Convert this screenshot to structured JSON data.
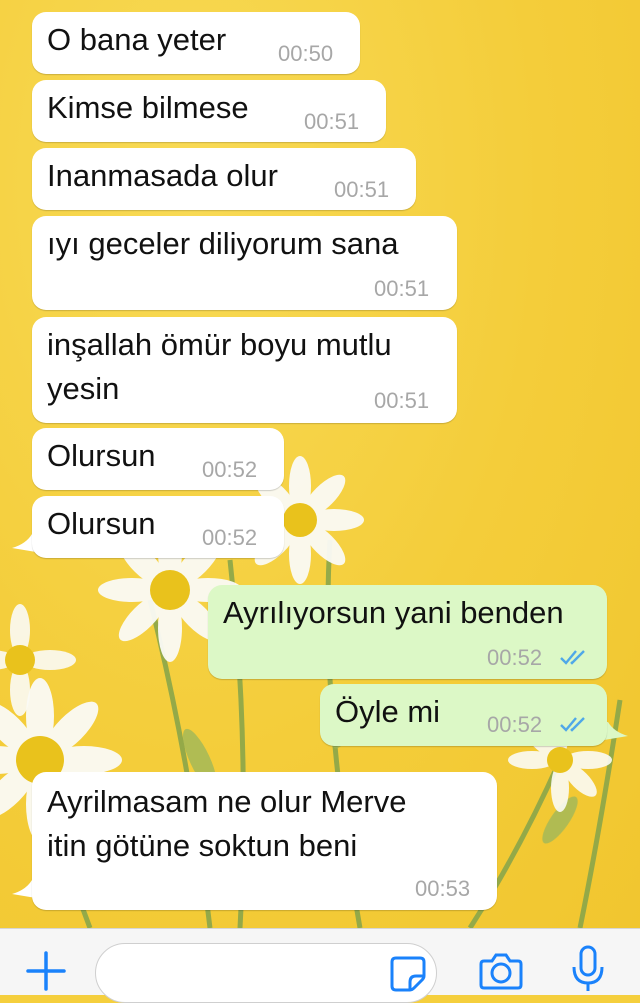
{
  "messages": [
    {
      "direction": "incoming",
      "text": "O bana yeter",
      "time": "00:50"
    },
    {
      "direction": "incoming",
      "text": "Kimse bilmese",
      "time": "00:51"
    },
    {
      "direction": "incoming",
      "text": "Inanmasada olur",
      "time": "00:51"
    },
    {
      "direction": "incoming",
      "text": "ıyı geceler diliyorum sana",
      "time": "00:51"
    },
    {
      "direction": "incoming",
      "text_lines": [
        "inşallah ömür boyu mutlu",
        "yesin"
      ],
      "time": "00:51"
    },
    {
      "direction": "incoming",
      "text": "Olursun",
      "time": "00:52"
    },
    {
      "direction": "incoming",
      "text": "Olursun",
      "time": "00:52"
    },
    {
      "direction": "outgoing",
      "text": "Ayrılıyorsun yani benden",
      "time": "00:52",
      "status": "read"
    },
    {
      "direction": "outgoing",
      "text": "Öyle mi",
      "time": "00:52",
      "status": "read"
    },
    {
      "direction": "incoming",
      "text_lines": [
        "Ayrilmasam ne olur Merve",
        "itin götüne soktun beni"
      ],
      "time": "00:53"
    }
  ],
  "input_bar": {
    "left_icon": "plus-icon",
    "right_icons": [
      "sticker-icon",
      "camera-icon",
      "microphone-icon"
    ],
    "accent_color": "#1a82fb"
  },
  "colors": {
    "incoming_bubble": "#ffffff",
    "outgoing_bubble": "#dcf8c6",
    "read_ticks": "#4fa8e8",
    "wallpaper": "#f5cf3d"
  }
}
